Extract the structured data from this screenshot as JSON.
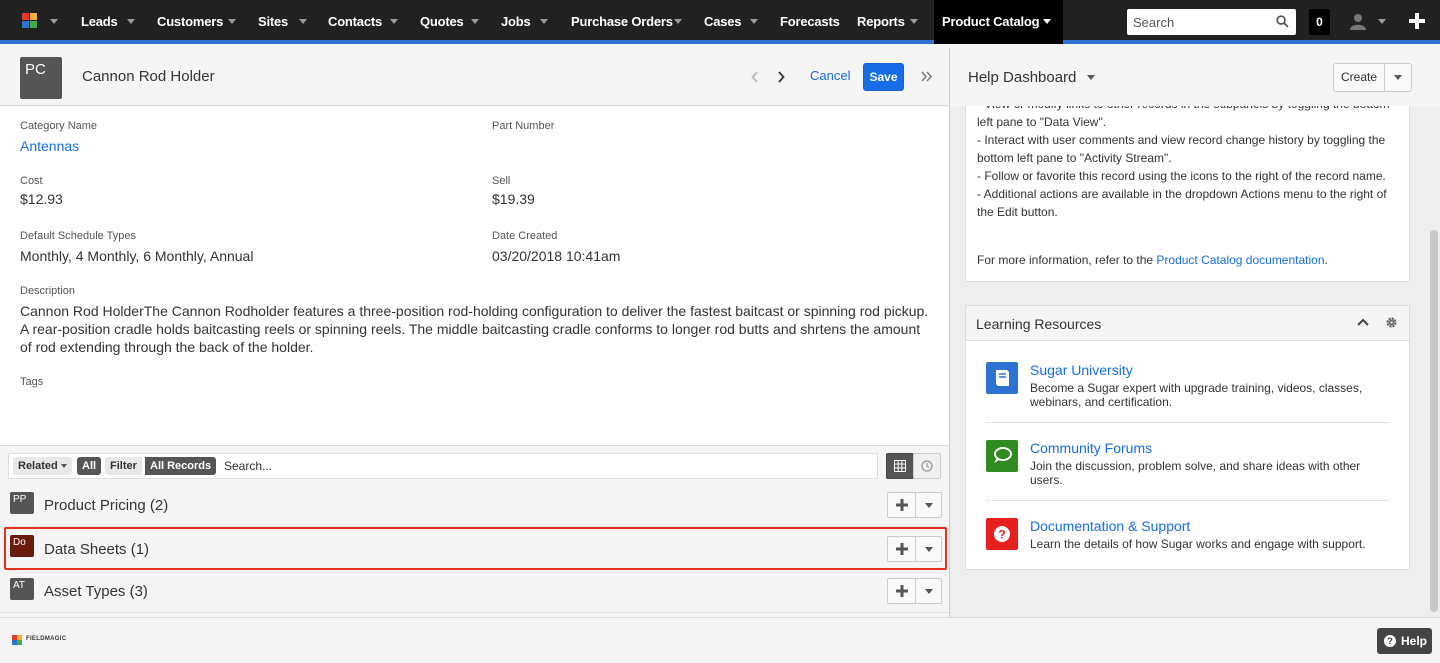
{
  "nav": {
    "items": [
      "Leads",
      "Customers",
      "Sites",
      "Contacts",
      "Quotes",
      "Jobs",
      "Purchase Orders",
      "Cases",
      "Forecasts",
      "Reports",
      "Product Catalog"
    ],
    "search_placeholder": "Search",
    "notification_count": "0"
  },
  "record": {
    "icon_initials": "PC",
    "name": "Cannon Rod Holder",
    "cancel_label": "Cancel",
    "save_label": "Save",
    "fields": {
      "category_label": "Category Name",
      "category_value": "Antennas",
      "part_label": "Part Number",
      "part_value": "",
      "cost_label": "Cost",
      "cost_value": "$12.93",
      "sell_label": "Sell",
      "sell_value": "$19.39",
      "schedule_label": "Default Schedule Types",
      "schedule_value": "Monthly, 4 Monthly, 6 Monthly, Annual",
      "created_label": "Date Created",
      "created_value": "03/20/2018 10:41am",
      "desc_label": "Description",
      "desc_value": "Cannon Rod HolderThe Cannon Rodholder features a three-position rod-holding configuration to deliver the fastest baitcast or spinning rod pickup. A rear-position cradle holds baitcasting reels or spinning reels. The middle baitcasting cradle conforms to longer rod butts and shrtens the amount of rod extending through the back of the holder.",
      "tags_label": "Tags"
    }
  },
  "filter_bar": {
    "related": "Related",
    "all": "All",
    "filter": "Filter",
    "all_records": "All Records",
    "search_placeholder": "Search..."
  },
  "subpanels": [
    {
      "badge": "PP",
      "title": "Product Pricing (2)",
      "color": "#555555"
    },
    {
      "badge": "Do",
      "title": "Data Sheets (1)",
      "color": "#6b1b0e"
    },
    {
      "badge": "AT",
      "title": "Asset Types (3)",
      "color": "#555555"
    }
  ],
  "dashboard": {
    "title": "Help Dashboard",
    "create_label": "Create",
    "help_lines": [
      "- View or modify links to other records in the subpanels by toggling the bottom left pane to \"Data View\".",
      "- Interact with user comments and view record change history by toggling the bottom left pane to \"Activity Stream\".",
      "- Follow or favorite this record using the icons to the right of the record name.",
      "- Additional actions are available in the dropdown Actions menu to the right of the Edit button."
    ],
    "more_info_prefix": "For more information, refer to the ",
    "more_info_link": "Product Catalog documentation",
    "more_info_suffix": ".",
    "learning": {
      "title": "Learning Resources",
      "items": [
        {
          "name": "Sugar University",
          "desc": "Become a Sugar expert with upgrade training, videos, classes, webinars, and certification.",
          "color": "#2e72d2",
          "icon": "book-icon"
        },
        {
          "name": "Community Forums",
          "desc": "Join the discussion, problem solve, and share ideas with other users.",
          "color": "#2f8a1f",
          "icon": "chat-icon"
        },
        {
          "name": "Documentation & Support",
          "desc": "Learn the details of how Sugar works and engage with support.",
          "color": "#e61f1f",
          "icon": "question-icon"
        }
      ]
    }
  },
  "footer": {
    "logo_text": "FIELDMAGIC",
    "help_label": "Help"
  },
  "colors": {
    "accent": "#176de5",
    "nav_bg": "#212121",
    "nav_border": "#2e72d2",
    "highlight": "#e8311c"
  }
}
